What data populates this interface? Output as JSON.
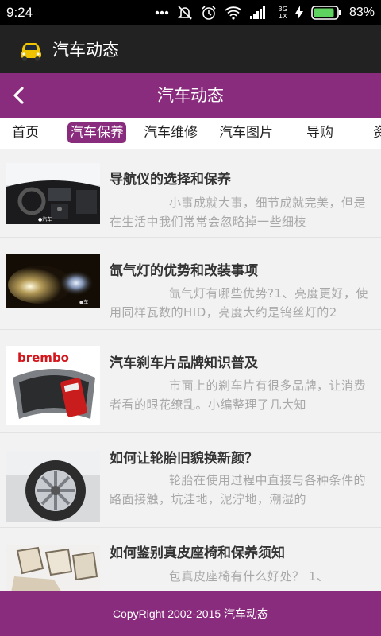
{
  "status": {
    "time": "9:24",
    "network_top": "3G",
    "network_bottom": "1X",
    "battery": "83%"
  },
  "app": {
    "title": "汽车动态"
  },
  "navbar": {
    "title": "汽车动态"
  },
  "tabs": [
    "首页",
    "汽车保养",
    "汽车维修",
    "汽车图片",
    "导购",
    "资"
  ],
  "active_tab": "汽车保养",
  "articles": [
    {
      "title": "导航仪的选择和保养",
      "summary": "小事成就大事，细节成就完美，但是在生活中我们常常会忽略掉一些细枝",
      "image": "car-dashboard-image"
    },
    {
      "title": "氙气灯的优势和改装事项",
      "summary": "氙气灯有哪些优势?1、亮度更好，使用同样瓦数的HID，亮度大约是钨丝灯的2",
      "image": "headlight-image"
    },
    {
      "title": "汽车刹车片品牌知识普及",
      "summary": "市面上的刹车片有很多品牌，让消费者看的眼花缭乱。小编整理了几大知",
      "image": "brembo-brake-pad-image",
      "image_text": "brembo"
    },
    {
      "title": "如何让轮胎旧貌换新颜？",
      "summary": "轮胎在使用过程中直接与各种条件的路面接触，坑洼地，泥泞地，潮湿的",
      "image": "tire-image"
    },
    {
      "title": "如何鉴别真皮座椅和保养须知",
      "summary": "包真皮座椅有什么好处？ 1、",
      "image": "leather-seat-image"
    }
  ],
  "footer": {
    "text": "CopyRight 2002-2015 汽车动态"
  },
  "colors": {
    "accent": "#8a2c7d",
    "titlebar": "#222222",
    "statusbar": "#000000"
  }
}
